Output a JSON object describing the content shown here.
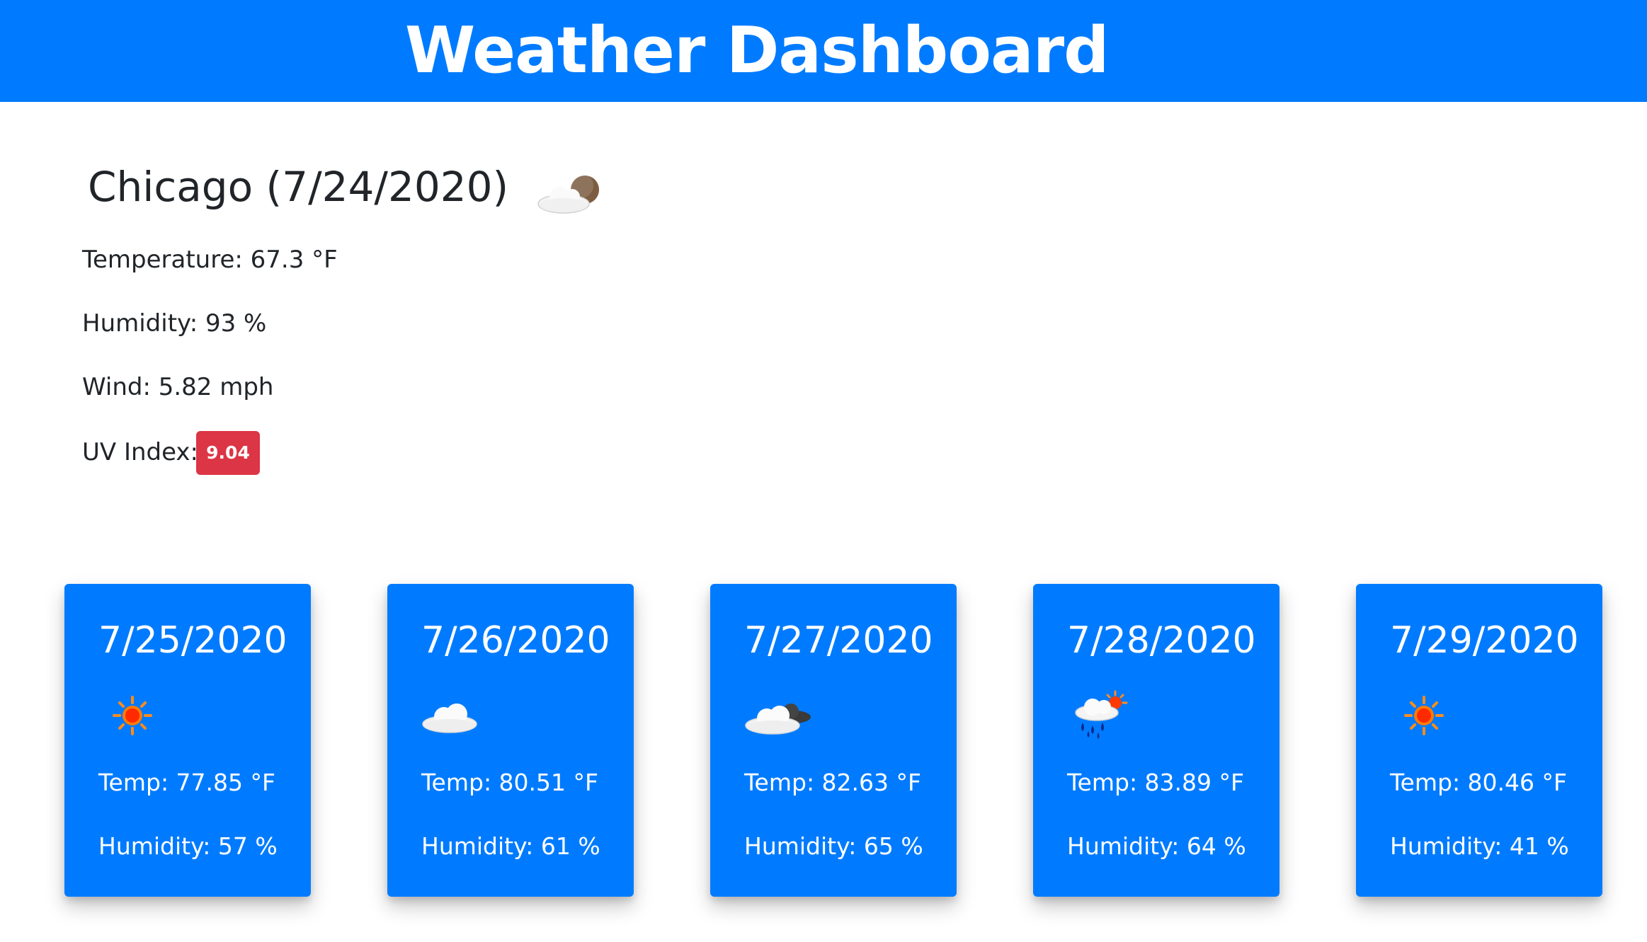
{
  "header": {
    "title": "Weather Dashboard",
    "background_color": "#007bff"
  },
  "current": {
    "heading": "Chicago (7/24/2020)",
    "icon": "cloudy-night-icon",
    "temperature": "Temperature: 67.3 °F",
    "humidity": "Humidity: 93 %",
    "wind": "Wind: 5.82 mph",
    "uv_label": "UV Index:",
    "uv_value": "9.04",
    "uv_color": "#dc3545"
  },
  "forecast": [
    {
      "date": "7/25/2020",
      "icon": "sun-icon",
      "temp": "Temp: 77.85 °F",
      "humidity": "Humidity: 57 %"
    },
    {
      "date": "7/26/2020",
      "icon": "cloud-icon",
      "temp": "Temp: 80.51 °F",
      "humidity": "Humidity: 61 %"
    },
    {
      "date": "7/27/2020",
      "icon": "broken-clouds-icon",
      "temp": "Temp: 82.63 °F",
      "humidity": "Humidity: 65 %"
    },
    {
      "date": "7/28/2020",
      "icon": "rain-sun-icon",
      "temp": "Temp: 83.89 °F",
      "humidity": "Humidity: 64 %"
    },
    {
      "date": "7/29/2020",
      "icon": "sun-icon",
      "temp": "Temp: 80.46 °F",
      "humidity": "Humidity: 41 %"
    }
  ],
  "colors": {
    "card": "#007bff",
    "text_on_card": "#ffffff"
  }
}
